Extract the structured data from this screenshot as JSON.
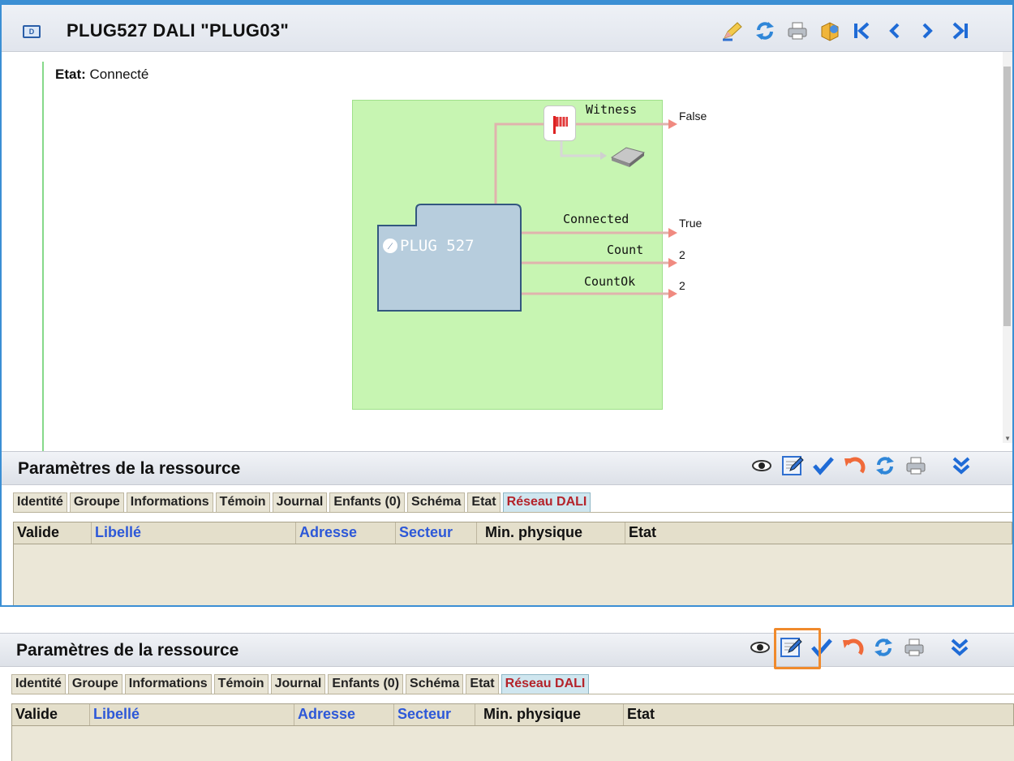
{
  "window": {
    "title_icon": "module-icon",
    "title": "PLUG527  DALI \"PLUG03\"",
    "toolbar_icons": [
      "edit-pencil-icon",
      "refresh-icon",
      "print-icon",
      "export-icon",
      "first-icon",
      "previous-icon",
      "next-icon",
      "last-icon"
    ]
  },
  "status": {
    "label": "Etat:",
    "value": "Connecté"
  },
  "diagram": {
    "block_label": "PLUG 527",
    "signals": [
      {
        "name": "Witness",
        "value": "False"
      },
      {
        "name": "Connected",
        "value": "True"
      },
      {
        "name": "Count",
        "value": "2"
      },
      {
        "name": "CountOk",
        "value": "2"
      }
    ],
    "colors": {
      "panel": "#c7f5b2",
      "block": "#b7cddd",
      "wire": "#e0b3ad",
      "arrow": "#f08a80"
    }
  },
  "params": {
    "title": "Paramètres de la ressource",
    "toolbar_icons": [
      "view-icon",
      "edit-icon",
      "validate-icon",
      "undo-icon",
      "refresh-icon",
      "print-icon",
      "collapse-icon"
    ],
    "tabs": [
      "Identité",
      "Groupe",
      "Informations",
      "Témoin",
      "Journal",
      "Enfants (0)",
      "Schéma",
      "Etat",
      "Réseau DALI"
    ],
    "active_tab": "Réseau DALI",
    "columns": [
      "Valide",
      "Libellé",
      "Adresse",
      "Secteur",
      "Min. physique",
      "Etat"
    ]
  },
  "highlight": {
    "target": "edit-icon",
    "color": "#f08a2c"
  }
}
